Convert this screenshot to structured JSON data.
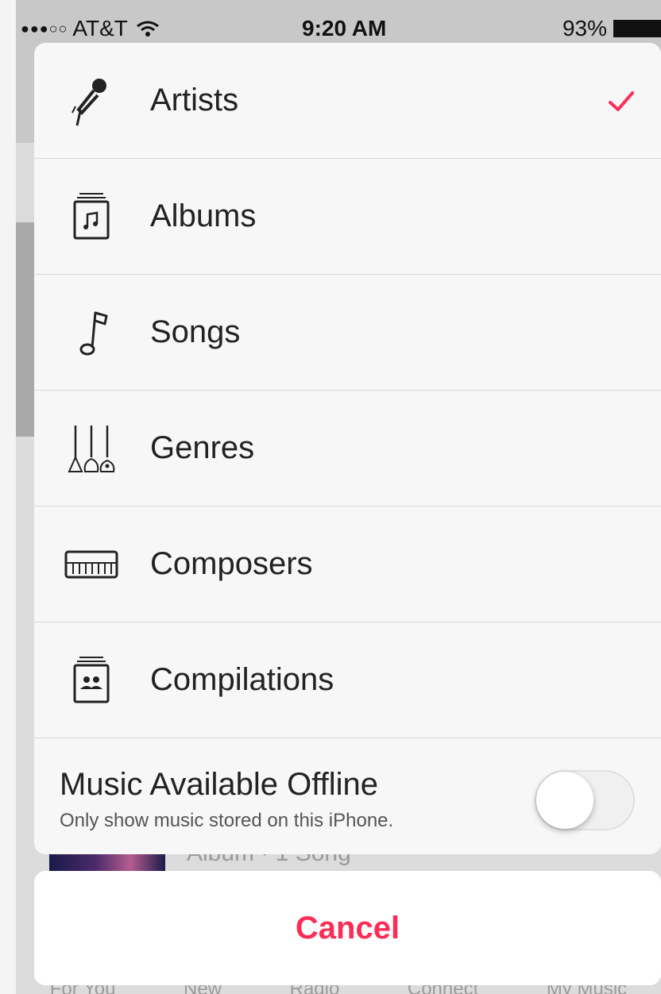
{
  "status_bar": {
    "signal_dots": "●●●○○",
    "carrier": "AT&T",
    "time": "9:20 AM",
    "battery_percent": "93%"
  },
  "menu": {
    "items": [
      {
        "label": "Artists",
        "icon": "microphone-icon",
        "selected": true
      },
      {
        "label": "Albums",
        "icon": "album-icon",
        "selected": false
      },
      {
        "label": "Songs",
        "icon": "music-note-icon",
        "selected": false
      },
      {
        "label": "Genres",
        "icon": "guitars-icon",
        "selected": false
      },
      {
        "label": "Composers",
        "icon": "piano-keyboard-icon",
        "selected": false
      },
      {
        "label": "Compilations",
        "icon": "compilation-icon",
        "selected": false
      }
    ],
    "offline": {
      "title": "Music Available Offline",
      "subtitle": "Only show music stored on this iPhone.",
      "enabled": false
    }
  },
  "cancel": {
    "label": "Cancel"
  },
  "background": {
    "album_text": "Album · 1 Song",
    "tabs": [
      "For You",
      "New",
      "Radio",
      "Connect",
      "My Music"
    ]
  },
  "colors": {
    "accent": "#ff2d55",
    "sheet": "#f7f7f7"
  }
}
